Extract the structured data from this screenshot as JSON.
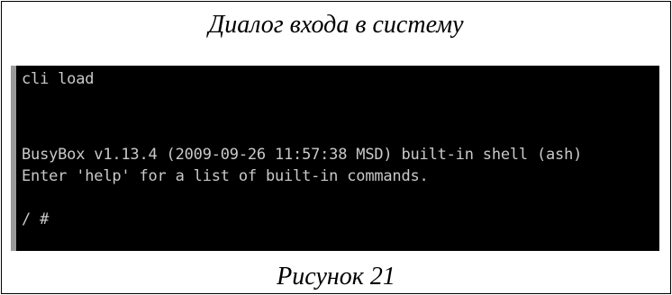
{
  "title": "Диалог входа в систему",
  "terminal": {
    "lines": [
      "cli load",
      "",
      "",
      "BusyBox v1.13.4 (2009-09-26 11:57:38 MSD) built-in shell (ash)",
      "Enter 'help' for a list of built-in commands.",
      "",
      "/ #"
    ],
    "background": "#000000",
    "text_color": "#c9c9c9"
  },
  "figure_caption": "Рисунок 21"
}
